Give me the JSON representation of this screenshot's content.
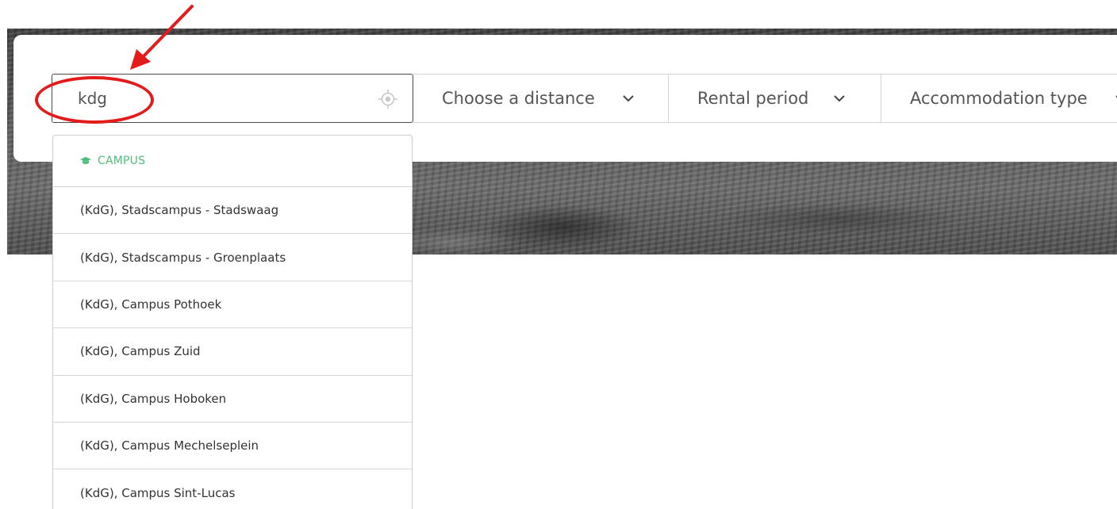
{
  "search": {
    "location_value": "kdg",
    "location_icon": "crosshair-location-icon"
  },
  "filters": [
    {
      "label": "Choose a distance",
      "icon": "chevron-down-icon"
    },
    {
      "label": "Rental period",
      "icon": "chevron-down-icon"
    },
    {
      "label": "Accommodation type",
      "icon": "chevron-down-icon"
    }
  ],
  "dropdown": {
    "section_label": "CAMPUS",
    "section_icon": "graduation-cap-icon",
    "section_color": "#4fbe7d",
    "items": [
      "(KdG), Stadscampus - Stadswaag",
      "(KdG), Stadscampus - Groenplaats",
      "(KdG), Campus Pothoek",
      "(KdG), Campus Zuid",
      "(KdG), Campus Hoboken",
      "(KdG), Campus Mechelseplein",
      "(KdG), Campus Sint-Lucas"
    ]
  },
  "annotation": {
    "color": "#e31b1b",
    "shapes": [
      "arrow",
      "ellipse"
    ]
  }
}
